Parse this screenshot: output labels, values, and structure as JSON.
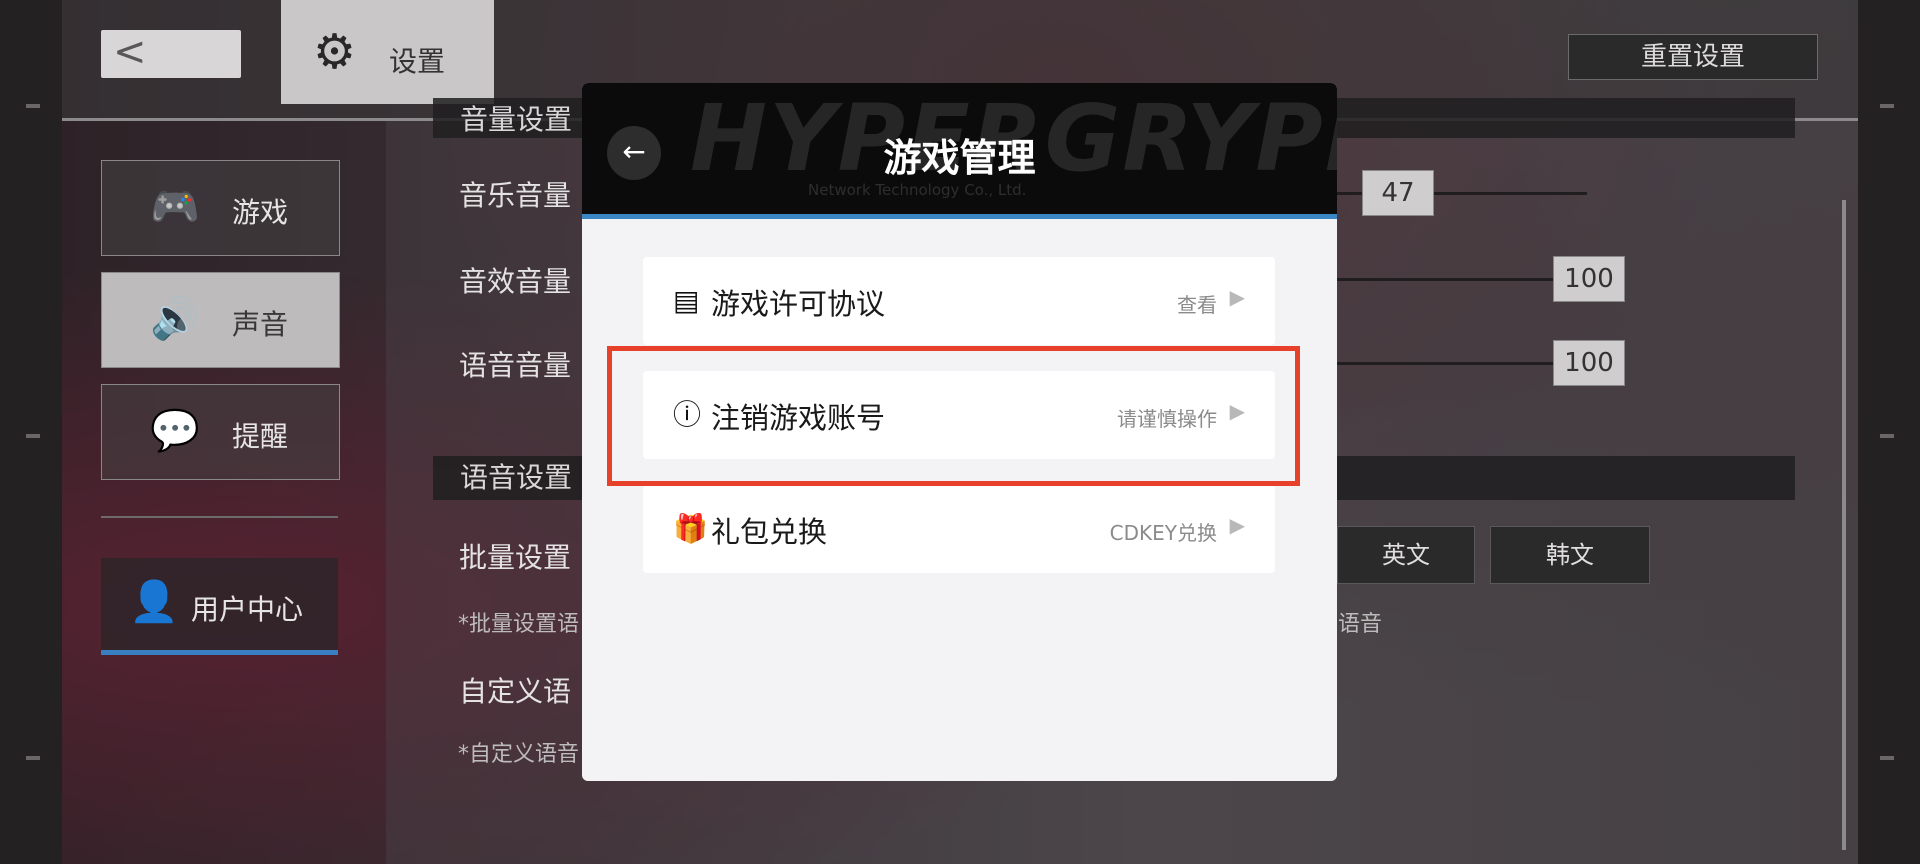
{
  "top_bar": {
    "back_icon": "chevron-left-icon",
    "settings_tab_label": "设置",
    "settings_icon": "gear-icon",
    "reset_button": "重置设置"
  },
  "nav": {
    "items": [
      {
        "label": "游戏",
        "icon": "gamepad-icon",
        "active": false
      },
      {
        "label": "声音",
        "icon": "speaker-icon",
        "active": true
      },
      {
        "label": "提醒",
        "icon": "chat-bubble-icon",
        "active": false
      }
    ],
    "user_center": {
      "label": "用户中心",
      "icon": "user-icon"
    }
  },
  "main": {
    "sections": {
      "volume_header": "音量设置",
      "voice_header": "语音设置"
    },
    "rows": [
      {
        "label": "音乐音量",
        "value": "47"
      },
      {
        "label": "音效音量",
        "value": "100"
      },
      {
        "label": "语音音量",
        "value": "100"
      }
    ],
    "batch_label": "批量设置",
    "batch_note": "*批量设置语",
    "batch_note_tail": "语音",
    "languages": [
      "英文",
      "韩文"
    ],
    "custom_label": "自定义语",
    "custom_note": "*自定义语音"
  },
  "modal": {
    "title": "游戏管理",
    "watermark": "HYPERGRYPH",
    "watermark_sub": "Network Technology Co., Ltd.",
    "back_icon": "back-arrow-icon",
    "items": [
      {
        "label": "游戏许可协议",
        "hint": "查看",
        "icon": "document-icon"
      },
      {
        "label": "注销游戏账号",
        "hint": "请谨慎操作",
        "icon": "info-icon"
      },
      {
        "label": "礼包兑换",
        "hint": "CDKEY兑换",
        "icon": "gift-icon"
      }
    ]
  },
  "colors": {
    "accent_blue": "#3b86c6",
    "highlight_red": "#e8412b",
    "modal_bg": "#f3f3f5",
    "modal_header": "#0b0b0b"
  }
}
